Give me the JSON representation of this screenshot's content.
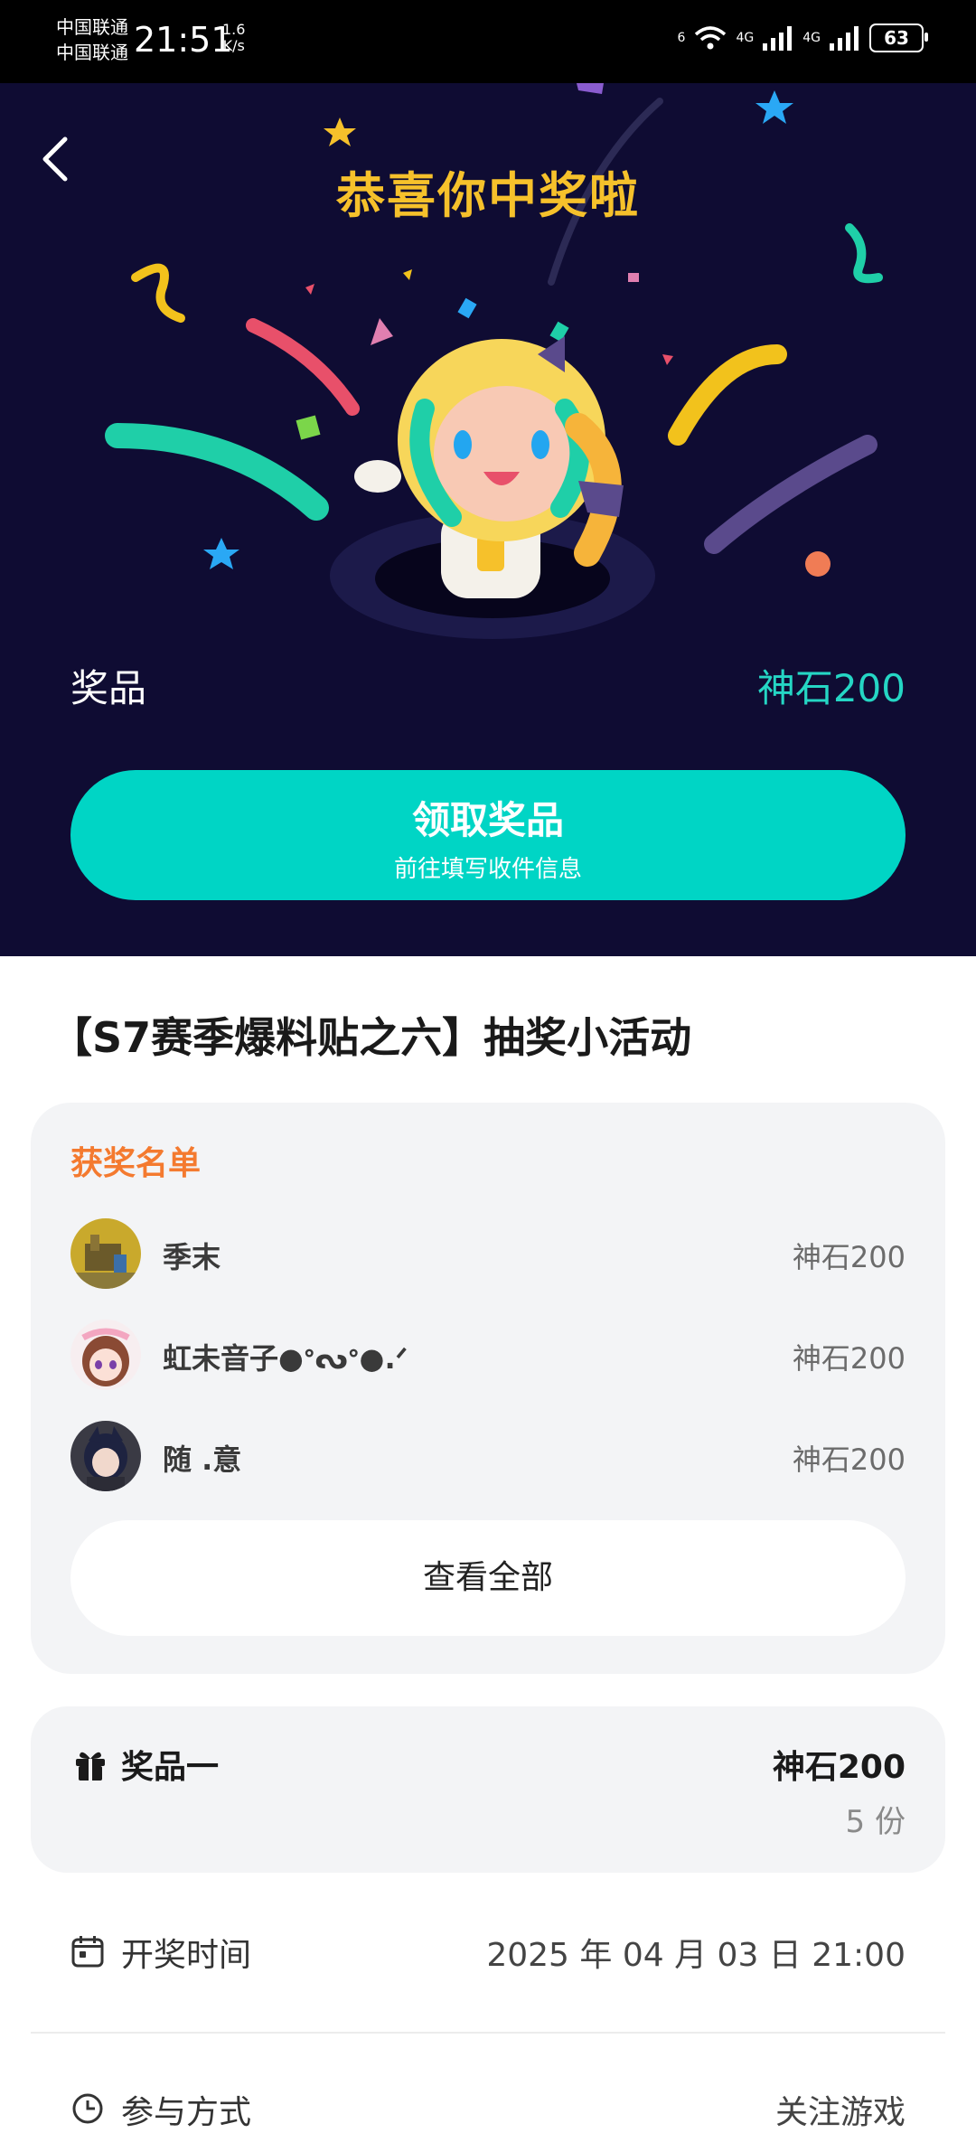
{
  "status_bar": {
    "carrier1": "中国联通",
    "carrier2": "中国联通",
    "time": "21:51",
    "speed_value": "1.6",
    "speed_unit": "K/s",
    "wifi_tag": "6",
    "net1": "4G",
    "net2": "4G",
    "battery": "63"
  },
  "hero": {
    "title": "恭喜你中奖啦",
    "prize_label": "奖品",
    "prize_value": "神石200",
    "claim_button": "领取奖品",
    "claim_hint": "前往填写收件信息",
    "colors": {
      "background": "#0f0c33",
      "title": "#f6c12b",
      "accent": "#00d5c5"
    }
  },
  "event": {
    "title": "【S7赛季爆料贴之六】抽奖小活动"
  },
  "winners": {
    "title": "获奖名单",
    "list": [
      {
        "name": "季末",
        "prize": "神石200"
      },
      {
        "name": "虹未音子●ᐤᔓᐤ●.ᐟ",
        "prize": "神石200"
      },
      {
        "name": "随 .意",
        "prize": "神石200"
      }
    ],
    "view_all": "查看全部"
  },
  "prize": {
    "name": "奖品一",
    "value": "神石200",
    "count": "5 份"
  },
  "draw": {
    "label": "开奖时间",
    "value": "2025 年 04 月 03 日 21:00"
  },
  "join": {
    "label": "参与方式",
    "value": "关注游戏"
  }
}
